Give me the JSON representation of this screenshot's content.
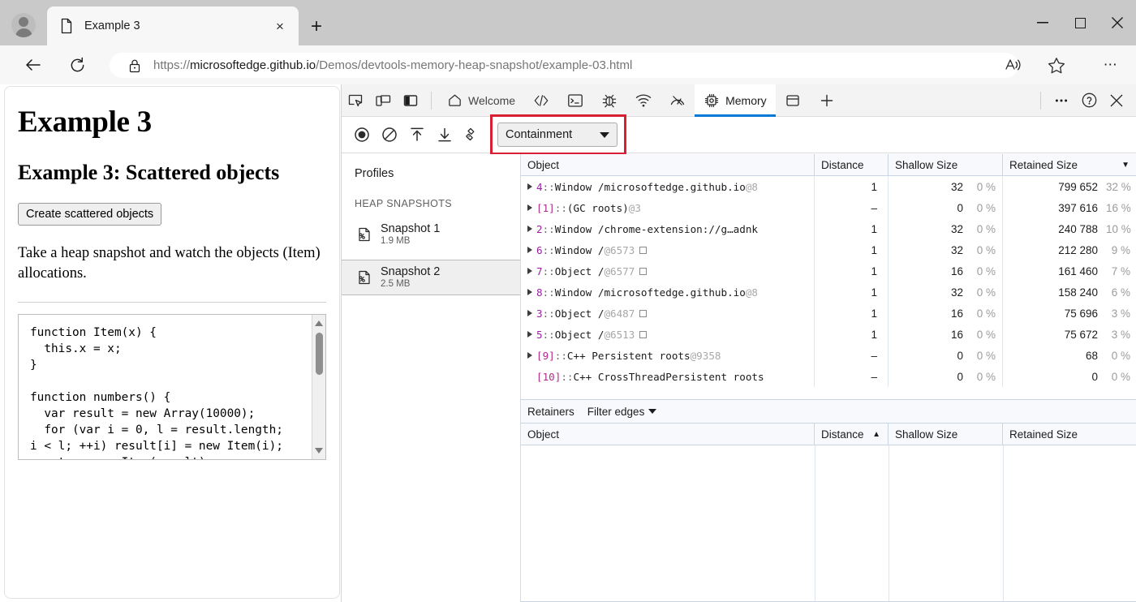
{
  "window": {
    "minimize_label": "Minimize",
    "maximize_label": "Maximize",
    "close_label": "Close"
  },
  "browser": {
    "tab": {
      "title": "Example 3",
      "favicon": "page-icon",
      "close_label": "×"
    },
    "new_tab_label": "+",
    "address": {
      "scheme": "https://",
      "host": "microsoftedge.github.io",
      "path": "/Demos/devtools-memory-heap-snapshot/example-03.html",
      "full": "https://microsoftedge.github.io/Demos/devtools-memory-heap-snapshot/example-03.html"
    },
    "icons": {
      "back": "back-arrow-icon",
      "reload": "reload-icon",
      "lock": "lock-icon",
      "read_aloud": "read-aloud-icon",
      "favorites": "star-icon",
      "settings": "ellipsis-icon"
    }
  },
  "page": {
    "h1": "Example 3",
    "h2": "Example 3: Scattered objects",
    "button_label": "Create scattered objects",
    "paragraph": "Take a heap snapshot and watch the objects (Item) allocations.",
    "code": "function Item(x) {\n  this.x = x;\n}\n\nfunction numbers() {\n  var result = new Array(10000);\n  for (var i = 0, l = result.length;\ni < l; ++i) result[i] = new Item(i);\n  return new Item(result);"
  },
  "devtools": {
    "tabs": [
      {
        "label": "Welcome",
        "icon": "home-icon",
        "active": false
      },
      {
        "label": "",
        "icon": "elements-icon",
        "active": false
      },
      {
        "label": "",
        "icon": "console-icon",
        "active": false
      },
      {
        "label": "",
        "icon": "debugger-bug-icon",
        "active": false
      },
      {
        "label": "",
        "icon": "network-icon",
        "active": false
      },
      {
        "label": "",
        "icon": "performance-icon",
        "active": false
      },
      {
        "label": "Memory",
        "icon": "memory-chip-icon",
        "active": true
      },
      {
        "label": "",
        "icon": "application-icon",
        "active": false
      },
      {
        "label": "",
        "icon": "plus-icon",
        "active": false
      }
    ],
    "left_icons": [
      "inspect-icon",
      "device-emulation-icon",
      "dock-side-icon"
    ],
    "right_icons": [
      "more-tools-icon",
      "help-icon",
      "close-devtools-icon"
    ],
    "toolbar": {
      "record_label": "record-icon",
      "clear_label": "clear-icon",
      "load_label": "load-icon",
      "save_label": "save-icon",
      "collect_garbage_label": "collect-garbage-icon",
      "view_select": "Containment",
      "highlight_color": "#d81f33"
    },
    "sidebar": {
      "title": "Profiles",
      "group_label": "HEAP SNAPSHOTS",
      "items": [
        {
          "name": "Snapshot 1",
          "size": "1.9 MB",
          "selected": false,
          "icon": "snapshot-icon"
        },
        {
          "name": "Snapshot 2",
          "size": "2.5 MB",
          "selected": true,
          "icon": "snapshot-icon"
        }
      ]
    },
    "grid": {
      "columns": [
        "Object",
        "Distance",
        "Shallow Size",
        "Retained Size"
      ],
      "sorted_column": "Retained Size",
      "sort_direction": "descending",
      "sort_mark": "▼",
      "rows": [
        {
          "expandable": true,
          "index": "4",
          "bracket": false,
          "kind": "Window",
          "slash": "/",
          "detail": "microsoftedge.github.io",
          "at": "@8",
          "box": false,
          "distance": "1",
          "shallow": "32",
          "shallow_pct": "0 %",
          "retained": "799 652",
          "retained_pct": "32 %"
        },
        {
          "expandable": true,
          "index": "[1]",
          "bracket": true,
          "kind": "(GC roots)",
          "slash": "",
          "detail": "",
          "at": "@3",
          "box": false,
          "distance": "–",
          "shallow": "0",
          "shallow_pct": "0 %",
          "retained": "397 616",
          "retained_pct": "16 %"
        },
        {
          "expandable": true,
          "index": "2",
          "bracket": false,
          "kind": "Window",
          "slash": "/",
          "detail": "chrome-extension://g…adnk",
          "at": "",
          "box": false,
          "distance": "1",
          "shallow": "32",
          "shallow_pct": "0 %",
          "retained": "240 788",
          "retained_pct": "10 %"
        },
        {
          "expandable": true,
          "index": "6",
          "bracket": false,
          "kind": "Window",
          "slash": "/",
          "detail": "",
          "at": "@6573",
          "box": true,
          "distance": "1",
          "shallow": "32",
          "shallow_pct": "0 %",
          "retained": "212 280",
          "retained_pct": "9 %"
        },
        {
          "expandable": true,
          "index": "7",
          "bracket": false,
          "kind": "Object",
          "slash": "/",
          "detail": "",
          "at": "@6577",
          "box": true,
          "distance": "1",
          "shallow": "16",
          "shallow_pct": "0 %",
          "retained": "161 460",
          "retained_pct": "7 %"
        },
        {
          "expandable": true,
          "index": "8",
          "bracket": false,
          "kind": "Window",
          "slash": "/",
          "detail": "microsoftedge.github.io",
          "at": "@8",
          "box": false,
          "distance": "1",
          "shallow": "32",
          "shallow_pct": "0 %",
          "retained": "158 240",
          "retained_pct": "6 %"
        },
        {
          "expandable": true,
          "index": "3",
          "bracket": false,
          "kind": "Object",
          "slash": "/",
          "detail": "",
          "at": "@6487",
          "box": true,
          "distance": "1",
          "shallow": "16",
          "shallow_pct": "0 %",
          "retained": "75 696",
          "retained_pct": "3 %"
        },
        {
          "expandable": true,
          "index": "5",
          "bracket": false,
          "kind": "Object",
          "slash": "/",
          "detail": "",
          "at": "@6513",
          "box": true,
          "distance": "1",
          "shallow": "16",
          "shallow_pct": "0 %",
          "retained": "75 672",
          "retained_pct": "3 %"
        },
        {
          "expandable": true,
          "index": "[9]",
          "bracket": true,
          "kind": "C++ Persistent roots",
          "slash": "",
          "detail": "",
          "at": "@9358",
          "box": false,
          "distance": "–",
          "shallow": "0",
          "shallow_pct": "0 %",
          "retained": "68",
          "retained_pct": "0 %"
        },
        {
          "expandable": false,
          "index": "[10]",
          "bracket": true,
          "kind": "C++ CrossThreadPersistent roots",
          "slash": "",
          "detail": "",
          "at": "",
          "box": false,
          "distance": "–",
          "shallow": "0",
          "shallow_pct": "0 %",
          "retained": "0",
          "retained_pct": "0 %"
        }
      ]
    },
    "retainers": {
      "label": "Retainers",
      "filter_label": "Filter edges",
      "columns": [
        "Object",
        "Distance",
        "Shallow Size",
        "Retained Size"
      ],
      "sorted_column": "Distance",
      "sort_direction": "ascending",
      "sort_mark": "▲",
      "rows": []
    }
  }
}
